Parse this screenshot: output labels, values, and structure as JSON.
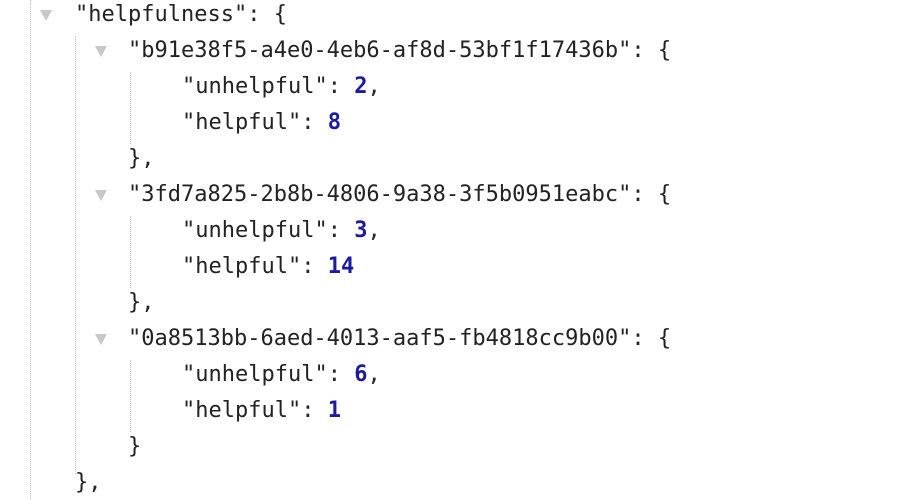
{
  "root": {
    "key": "helpfulness",
    "toggle_icon": "triangle-down-icon",
    "entries": [
      {
        "id": "b91e38f5-a4e0-4eb6-af8d-53bf1f17436b",
        "fields": [
          {
            "key": "unhelpful",
            "value": "2"
          },
          {
            "key": "helpful",
            "value": "8"
          }
        ]
      },
      {
        "id": "3fd7a825-2b8b-4806-9a38-3f5b0951eabc",
        "fields": [
          {
            "key": "unhelpful",
            "value": "3"
          },
          {
            "key": "helpful",
            "value": "14"
          }
        ]
      },
      {
        "id": "0a8513bb-6aed-4013-aaf5-fb4818cc9b00",
        "fields": [
          {
            "key": "unhelpful",
            "value": "6"
          },
          {
            "key": "helpful",
            "value": "1"
          }
        ]
      }
    ]
  },
  "colors": {
    "number": "#1a1aa6",
    "text": "#222222",
    "triangle": "#c8c8c8",
    "guide": "#c4c4c4"
  }
}
